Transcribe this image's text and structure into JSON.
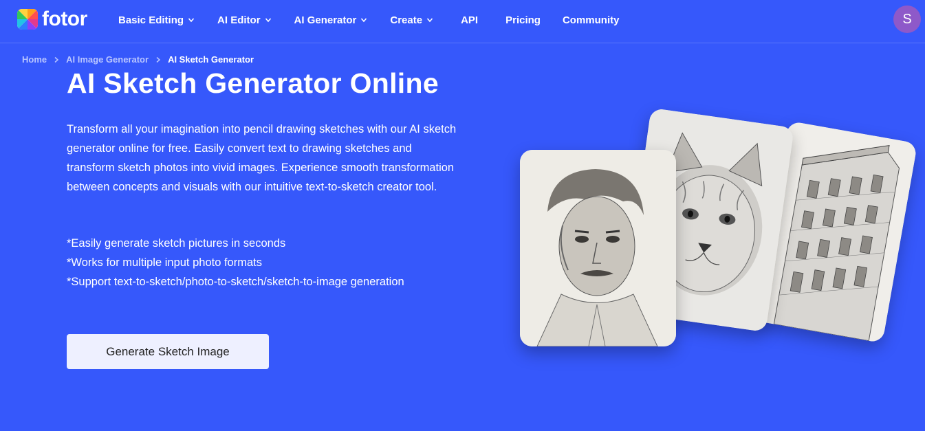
{
  "brand": {
    "name": "fotor"
  },
  "nav": {
    "items": [
      {
        "label": "Basic Editing",
        "has_dropdown": true
      },
      {
        "label": "AI Editor",
        "has_dropdown": true
      },
      {
        "label": "AI Generator",
        "has_dropdown": true
      },
      {
        "label": "Create",
        "has_dropdown": true
      },
      {
        "label": "API",
        "has_dropdown": false
      },
      {
        "label": "Pricing",
        "has_dropdown": false
      },
      {
        "label": "Community",
        "has_dropdown": false
      }
    ],
    "avatar_initial": "S"
  },
  "breadcrumb": {
    "home": "Home",
    "parent": "AI Image Generator",
    "current": "AI Sketch Generator"
  },
  "hero": {
    "title": "AI Sketch Generator Online",
    "description": "Transform all your imagination into pencil drawing sketches with our AI sketch generator online for free. Easily convert text to drawing sketches and transform sketch photos into vivid images. Experience smooth transformation between concepts and visuals with our intuitive text-to-sketch creator tool.",
    "features": [
      "*Easily generate sketch pictures in seconds",
      "*Works for multiple input photo formats",
      "*Support text-to-sketch/photo-to-sketch/sketch-to-image generation"
    ],
    "cta_label": "Generate Sketch Image"
  },
  "colors": {
    "background": "#3658fb",
    "cta_background": "#eef0ff",
    "avatar": "#8e59c9"
  }
}
